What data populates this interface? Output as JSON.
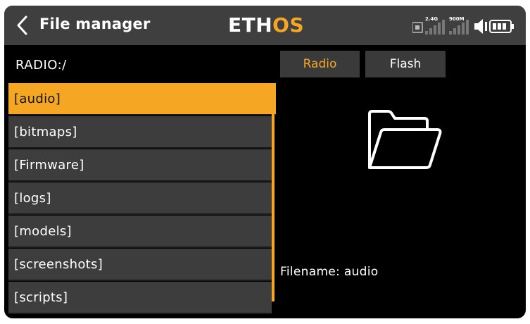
{
  "header": {
    "title": "File manager",
    "logo_main": "ETH",
    "logo_accent": "OS",
    "signal_24": "2.4G",
    "signal_900": "900M"
  },
  "path": "RADIO:/",
  "files": [
    {
      "label": "[audio]",
      "selected": true
    },
    {
      "label": "[bitmaps]"
    },
    {
      "label": "[Firmware]"
    },
    {
      "label": "[logs]"
    },
    {
      "label": "[models]"
    },
    {
      "label": "[screenshots]"
    },
    {
      "label": "[scripts]"
    }
  ],
  "tabs": {
    "radio": "Radio",
    "flash": "Flash",
    "active": "radio"
  },
  "preview": {
    "icon": "folder-open-icon",
    "filename_label": "Filename:",
    "filename_value": "audio"
  },
  "colors": {
    "accent": "#f5a623",
    "list_bg": "#3d3d3d",
    "topbar_bg": "#3f3f3f"
  }
}
